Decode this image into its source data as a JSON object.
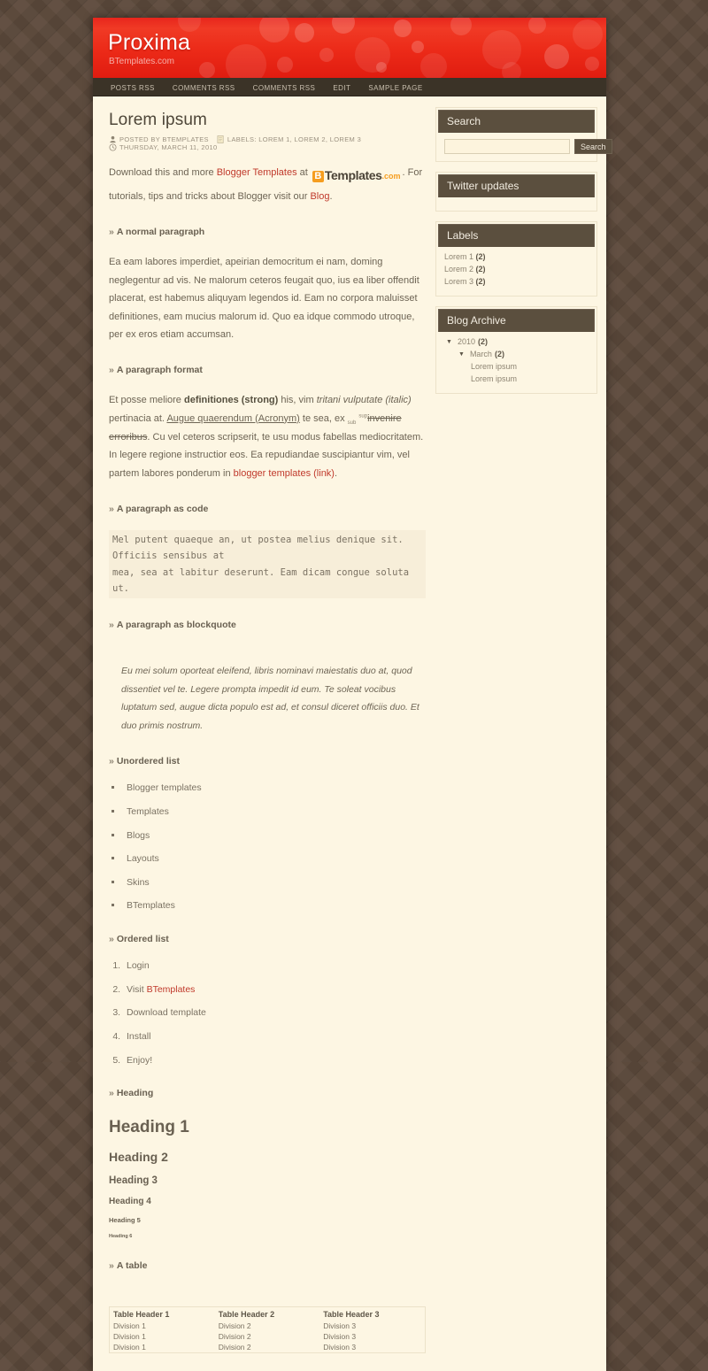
{
  "site": {
    "title": "Proxima",
    "description": "BTemplates.com"
  },
  "nav": {
    "items": [
      {
        "label": "POSTS RSS"
      },
      {
        "label": "COMMENTS RSS"
      },
      {
        "label": "COMMENTS RSS"
      },
      {
        "label": "EDIT"
      },
      {
        "label": "SAMPLE PAGE"
      }
    ]
  },
  "post": {
    "title": "Lorem ipsum",
    "meta": {
      "author": "POSTED BY BTEMPLATES",
      "labels": "LABELS: LOREM 1, LOREM 2, LOREM 3",
      "date": "THURSDAY, MARCH 11, 2010"
    },
    "intro": {
      "t1": "Download this and more ",
      "link1": "Blogger Templates",
      "t2": " at ",
      "logo_b": "B",
      "logo_templates": "Templates",
      "logo_com": ".com",
      "t3": ". For tutorials, tips and tricks about Blogger visit our ",
      "link2": "Blog",
      "t4": "."
    },
    "sections": {
      "normal_paragraph": "A normal paragraph",
      "paragraph_format": "A paragraph format",
      "paragraph_code": "A paragraph as code",
      "paragraph_blockquote": "A paragraph as blockquote",
      "unordered_list": "Unordered list",
      "ordered_list": "Ordered list",
      "heading": "Heading",
      "a_table": "A table"
    },
    "normal_text": "Ea eam labores imperdiet, apeirian democritum ei nam, doming neglegentur ad vis. Ne malorum ceteros feugait quo, ius ea liber offendit placerat, est habemus aliquyam legendos id. Eam no corpora maluisset definitiones, eam mucius malorum id. Quo ea idque commodo utroque, per ex eros etiam accumsan.",
    "format_paragraph": {
      "p1": "Et posse meliore ",
      "strong": "definitiones (strong)",
      "p2": " his, vim ",
      "italic": "tritani vulputate (italic)",
      "p3": " pertinacia at. ",
      "acronym": "Augue quaerendum (Acronym)",
      "p4": " te sea, ex ",
      "sub": "sub",
      "p5": " ",
      "sup": "sup",
      "del": "invenire erroribus",
      "p6": ". Cu vel ceteros scripserit, te usu modus fabellas mediocritatem. In legere regione instructior eos. Ea repudiandae suscipiantur vim, vel partem labores ponderum in ",
      "link": "blogger templates (link)",
      "p7": "."
    },
    "code_text": "Mel putent quaeque an, ut postea melius denique sit. Officiis sensibus at\nmea, sea at labitur deserunt. Eam dicam congue soluta ut.",
    "blockquote_text": "Eu mei solum oporteat eleifend, libris nominavi maiestatis duo at, quod dissentiet vel te. Legere prompta impedit id eum. Te soleat vocibus luptatum sed, augue dicta populo est ad, et consul diceret officiis duo. Et duo primis nostrum.",
    "ul_items": [
      {
        "label": "Blogger templates"
      },
      {
        "label": "Templates"
      },
      {
        "label": "Blogs"
      },
      {
        "label": "Layouts"
      },
      {
        "label": "Skins"
      },
      {
        "label": "BTemplates"
      }
    ],
    "ol_items": [
      {
        "prefix": "Login",
        "link": ""
      },
      {
        "prefix": "Visit ",
        "link": "BTemplates"
      },
      {
        "prefix": "Download template",
        "link": ""
      },
      {
        "prefix": "Install",
        "link": ""
      },
      {
        "prefix": "Enjoy!",
        "link": ""
      }
    ],
    "headings": {
      "h1": "Heading 1",
      "h2": "Heading 2",
      "h3": "Heading 3",
      "h4": "Heading 4",
      "h5": "Heading 5",
      "h6": "Heading 6"
    },
    "table": {
      "headers": [
        "Table Header 1",
        "Table Header 2",
        "Table Header 3"
      ],
      "rows": [
        [
          "Division 1",
          "Division 2",
          "Division 3"
        ],
        [
          "Division 1",
          "Division 2",
          "Division 3"
        ],
        [
          "Division 1",
          "Division 2",
          "Division 3"
        ]
      ]
    }
  },
  "sidebar": {
    "search": {
      "title": "Search",
      "value": "",
      "placeholder": "",
      "button": "Search"
    },
    "twitter": {
      "title": "Twitter updates"
    },
    "labels": {
      "title": "Labels",
      "items": [
        {
          "label": "Lorem 1",
          "count": "(2)"
        },
        {
          "label": "Lorem 2",
          "count": "(2)"
        },
        {
          "label": "Lorem 3",
          "count": "(2)"
        }
      ]
    },
    "archive": {
      "title": "Blog Archive",
      "year": {
        "label": "2010",
        "count": "(2)"
      },
      "month": {
        "label": "March",
        "count": "(2)"
      },
      "posts": [
        {
          "label": "Lorem ipsum"
        },
        {
          "label": "Lorem ipsum"
        }
      ]
    }
  },
  "colors": {
    "header_red": "#ec2a18",
    "page_bg": "#fdf6e3",
    "body_bg": "#5d4a3c",
    "nav_bg": "#3b3327",
    "widget_head": "#5b4f3e",
    "link_red": "#c0392b",
    "logo_orange": "#f59d1f"
  }
}
